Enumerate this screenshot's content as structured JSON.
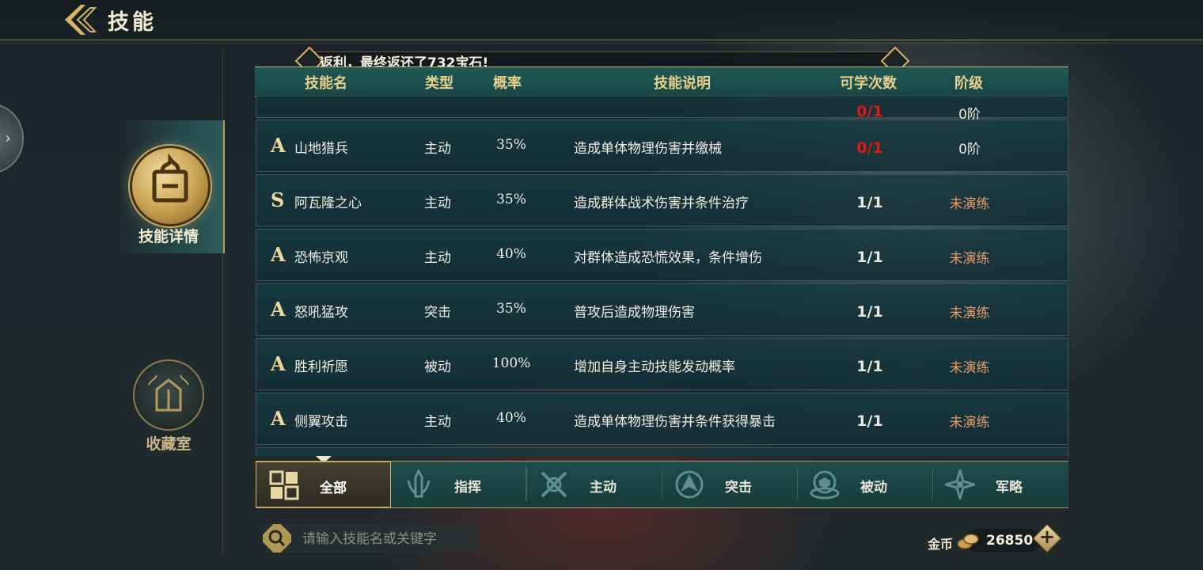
{
  "header": {
    "title": "技能"
  },
  "sidebar": {
    "tabs": [
      {
        "label": "技能详情",
        "active": true
      },
      {
        "label": "收藏室",
        "active": false
      }
    ]
  },
  "banner": {
    "text": "返利，最终返还了732宝石!"
  },
  "table": {
    "columns": [
      "技能名",
      "类型",
      "概率",
      "技能说明",
      "可学次数",
      "阶级"
    ],
    "rows": [
      {
        "grade": "A",
        "name": "山地猎兵",
        "type": "主动",
        "rate": "35%",
        "desc": "造成单体物理伤害并缴械",
        "times": "0/1",
        "times_color": "#e01818",
        "level": "0阶"
      },
      {
        "grade": "S",
        "name": "阿瓦隆之心",
        "type": "主动",
        "rate": "35%",
        "desc": "造成群体战术伤害并条件治疗",
        "times": "1/1",
        "level": "未演练"
      },
      {
        "grade": "A",
        "name": "恐怖京观",
        "type": "主动",
        "rate": "40%",
        "desc": "对群体造成恐慌效果，条件增伤",
        "times": "1/1",
        "level": "未演练"
      },
      {
        "grade": "A",
        "name": "怒吼猛攻",
        "type": "突击",
        "rate": "35%",
        "desc": "普攻后造成物理伤害",
        "times": "1/1",
        "level": "未演练"
      },
      {
        "grade": "A",
        "name": "胜利祈愿",
        "type": "被动",
        "rate": "100%",
        "desc": "增加自身主动技能发动概率",
        "times": "1/1",
        "level": "未演练"
      },
      {
        "grade": "A",
        "name": "侧翼攻击",
        "type": "主动",
        "rate": "40%",
        "desc": "造成单体物理伤害并条件获得暴击",
        "times": "1/1",
        "level": "未演练"
      }
    ],
    "partial_top": {
      "times": "0/1",
      "level": "0阶"
    }
  },
  "filters": [
    {
      "label": "全部",
      "icon": "grid-icon",
      "active": true
    },
    {
      "label": "指挥",
      "icon": "command-icon",
      "active": false
    },
    {
      "label": "主动",
      "icon": "crossed-swords-icon",
      "active": false
    },
    {
      "label": "突击",
      "icon": "charge-icon",
      "active": false
    },
    {
      "label": "被动",
      "icon": "shield-icon",
      "active": false
    },
    {
      "label": "军略",
      "icon": "star-compass-icon",
      "active": false
    }
  ],
  "search": {
    "placeholder": "请输入技能名或关键字"
  },
  "currency": {
    "label": "金币",
    "value": "26850",
    "plus": "+"
  },
  "colors": {
    "accent_gold": "#d7b46a",
    "level_orange": "#e89a6a",
    "alert_red": "#e01818",
    "teal": "#1f4c4c"
  }
}
